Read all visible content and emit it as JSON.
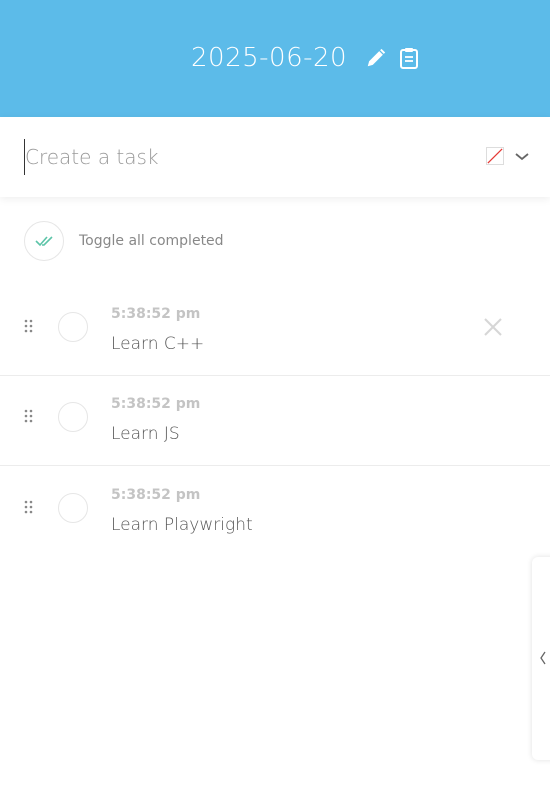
{
  "header": {
    "date": "2025-06-20",
    "edit_icon": "pencil-icon",
    "copy_icon": "clipboard-icon",
    "background": "#5cbbe9"
  },
  "create": {
    "placeholder": "Create a task",
    "value": "",
    "color_icon": "no-color-swatch-icon",
    "dropdown_icon": "chevron-down-icon"
  },
  "toggle_all": {
    "label": "Toggle all completed",
    "icon": "double-check-icon"
  },
  "tasks": [
    {
      "time": "5:38:52 pm",
      "title": "Learn C++",
      "completed": false
    },
    {
      "time": "5:38:52 pm",
      "title": "Learn JS",
      "completed": false
    },
    {
      "time": "5:38:52 pm",
      "title": "Learn Playwright",
      "completed": false
    }
  ],
  "side_panel": {
    "icon": "chevron-left-icon"
  }
}
